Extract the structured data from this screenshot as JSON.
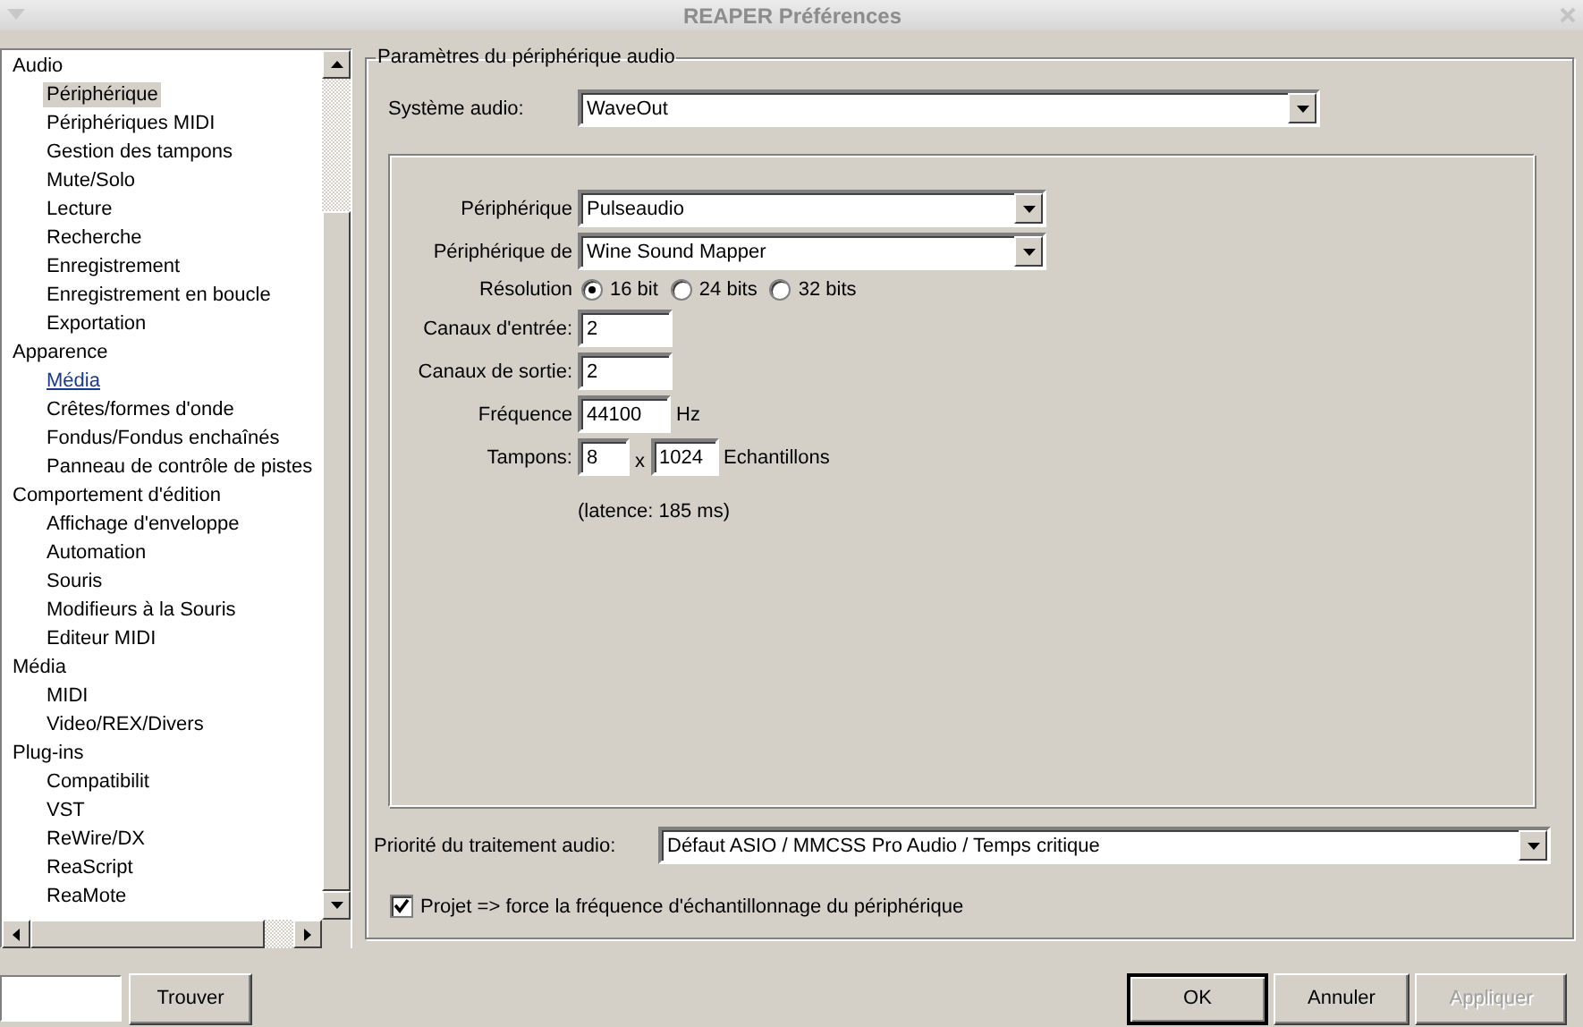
{
  "window": {
    "title": "REAPER Préférences"
  },
  "sidebar": {
    "tree": [
      {
        "label": "Audio",
        "selected": false,
        "hot": false,
        "children": [
          {
            "label": "Périphérique",
            "selected": true,
            "hot": false
          },
          {
            "label": "Périphériques MIDI",
            "selected": false,
            "hot": false
          },
          {
            "label": "Gestion des tampons",
            "selected": false,
            "hot": false
          },
          {
            "label": "Mute/Solo",
            "selected": false,
            "hot": false
          },
          {
            "label": "Lecture",
            "selected": false,
            "hot": false
          },
          {
            "label": "Recherche",
            "selected": false,
            "hot": false
          },
          {
            "label": "Enregistrement",
            "selected": false,
            "hot": false
          },
          {
            "label": "Enregistrement en boucle",
            "selected": false,
            "hot": false
          },
          {
            "label": "Exportation",
            "selected": false,
            "hot": false
          }
        ]
      },
      {
        "label": "Apparence",
        "selected": false,
        "hot": false,
        "children": [
          {
            "label": "Média",
            "selected": false,
            "hot": true
          },
          {
            "label": "Crêtes/formes d'onde",
            "selected": false,
            "hot": false
          },
          {
            "label": "Fondus/Fondus enchaînés",
            "selected": false,
            "hot": false
          },
          {
            "label": "Panneau de contrôle de pistes",
            "selected": false,
            "hot": false
          }
        ]
      },
      {
        "label": "Comportement d'édition",
        "selected": false,
        "hot": false,
        "children": [
          {
            "label": "Affichage d'enveloppe",
            "selected": false,
            "hot": false
          },
          {
            "label": "Automation",
            "selected": false,
            "hot": false
          },
          {
            "label": "Souris",
            "selected": false,
            "hot": false
          },
          {
            "label": "Modifieurs à la Souris",
            "selected": false,
            "hot": false
          },
          {
            "label": "Editeur MIDI",
            "selected": false,
            "hot": false
          }
        ]
      },
      {
        "label": "Média",
        "selected": false,
        "hot": false,
        "children": [
          {
            "label": "MIDI",
            "selected": false,
            "hot": false
          },
          {
            "label": "Video/REX/Divers",
            "selected": false,
            "hot": false
          }
        ]
      },
      {
        "label": "Plug-ins",
        "selected": false,
        "hot": false,
        "children": [
          {
            "label": "Compatibilit",
            "selected": false,
            "hot": false
          },
          {
            "label": "VST",
            "selected": false,
            "hot": false
          },
          {
            "label": "ReWire/DX",
            "selected": false,
            "hot": false
          },
          {
            "label": "ReaScript",
            "selected": false,
            "hot": false
          },
          {
            "label": "ReaMote",
            "selected": false,
            "hot": false
          }
        ]
      }
    ],
    "find_button": "Trouver"
  },
  "device_settings": {
    "title": "Paramètres du périphérique audio",
    "audio_system": {
      "label": "Système audio:",
      "value": "WaveOut"
    },
    "device_rows": [
      {
        "kind": "dropdown",
        "label": "Périphérique",
        "value": "Pulseaudio"
      },
      {
        "kind": "dropdown",
        "label": "Périphérique de",
        "value": "Wine Sound Mapper"
      },
      {
        "kind": "radio",
        "label": "Résolution",
        "options": [
          {
            "label": "16 bit",
            "selected": true
          },
          {
            "label": "24 bits",
            "selected": false
          },
          {
            "label": "32 bits",
            "selected": false
          }
        ]
      },
      {
        "kind": "input",
        "label": "Canaux d'entrée:",
        "value": "2"
      },
      {
        "kind": "input",
        "label": "Canaux de sortie:",
        "value": "2"
      },
      {
        "kind": "input",
        "label": "Fréquence",
        "value": "44100",
        "unit": "Hz"
      },
      {
        "kind": "buffers",
        "label": "Tampons:",
        "value": "8",
        "separator": "x",
        "value2": "1024",
        "unit": "Echantillons"
      },
      {
        "kind": "note",
        "text": "(latence: 185 ms)"
      }
    ],
    "priority": {
      "label": "Priorité du traitement audio:",
      "value": "Défaut ASIO / MMCSS Pro Audio / Temps critique"
    },
    "force_rate": {
      "label": "Projet => force la fréquence d'échantillonnage du périphérique",
      "checked": true
    }
  },
  "buttons": [
    {
      "label": "OK",
      "default": true,
      "disabled": false
    },
    {
      "label": "Annuler",
      "default": false,
      "disabled": false
    },
    {
      "label": "Appliquer",
      "default": false,
      "disabled": true
    }
  ]
}
